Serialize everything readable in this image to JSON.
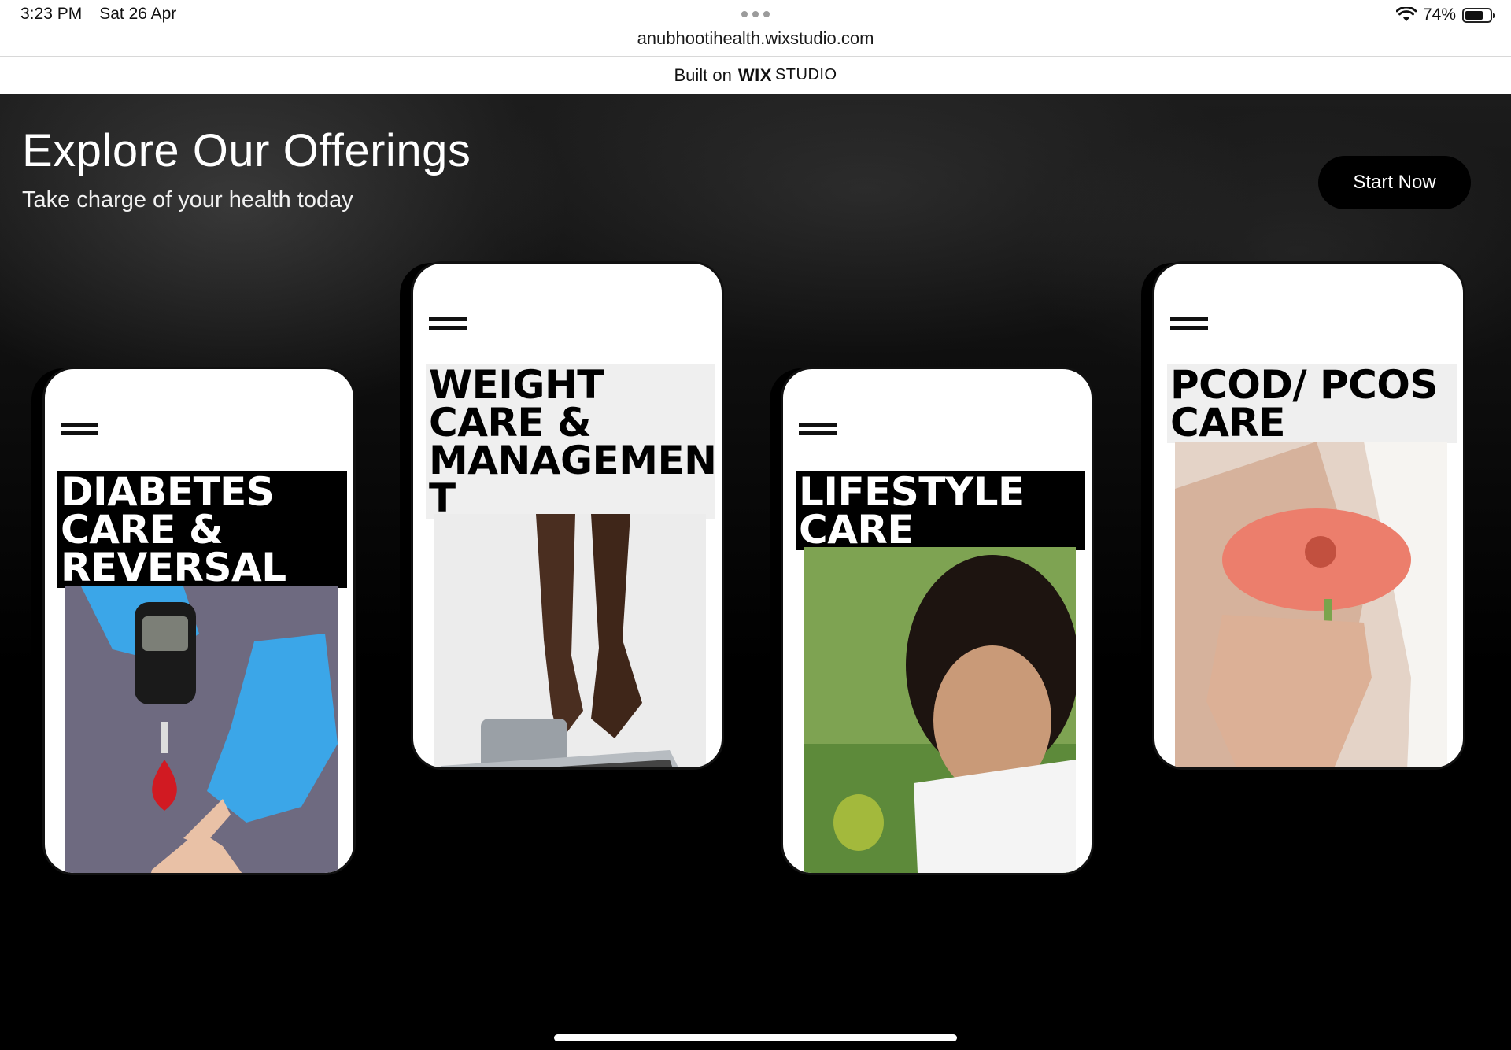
{
  "statusbar": {
    "time": "3:23 PM",
    "date": "Sat 26 Apr",
    "url": "anubhootihealth.wixstudio.com",
    "battery": "74%",
    "battery_level": 0.74
  },
  "builtbar": {
    "prefix": "Built on",
    "brand": "WIX",
    "product": "STUDIO"
  },
  "hero": {
    "title": "Explore Our Offerings",
    "subtitle": "Take charge of your health today",
    "cta_label": "Start Now"
  },
  "cards": [
    {
      "title_line1": "DIABETES",
      "title_line2": "CARE &",
      "title_line3": "REVERSAL",
      "title_line4": "",
      "style": "dark",
      "image": "glucose-meter-finger-prick"
    },
    {
      "title_line1": "WEIGHT",
      "title_line2": "CARE &",
      "title_line3": "MANAGEMEN",
      "title_line4": "T",
      "style": "light",
      "image": "feet-on-scale"
    },
    {
      "title_line1": "LIFESTYLE",
      "title_line2": "CARE",
      "title_line3": "",
      "title_line4": "",
      "style": "dark",
      "image": "woman-eating-fruit"
    },
    {
      "title_line1": "PCOD/ PCOS",
      "title_line2": "CARE",
      "title_line3": "",
      "title_line4": "",
      "style": "light",
      "image": "hand-holding-flower"
    }
  ],
  "colors": {
    "accent_star": "#a9d4f5",
    "card_bg": "#ffffff",
    "hero_bg": "#000000"
  }
}
